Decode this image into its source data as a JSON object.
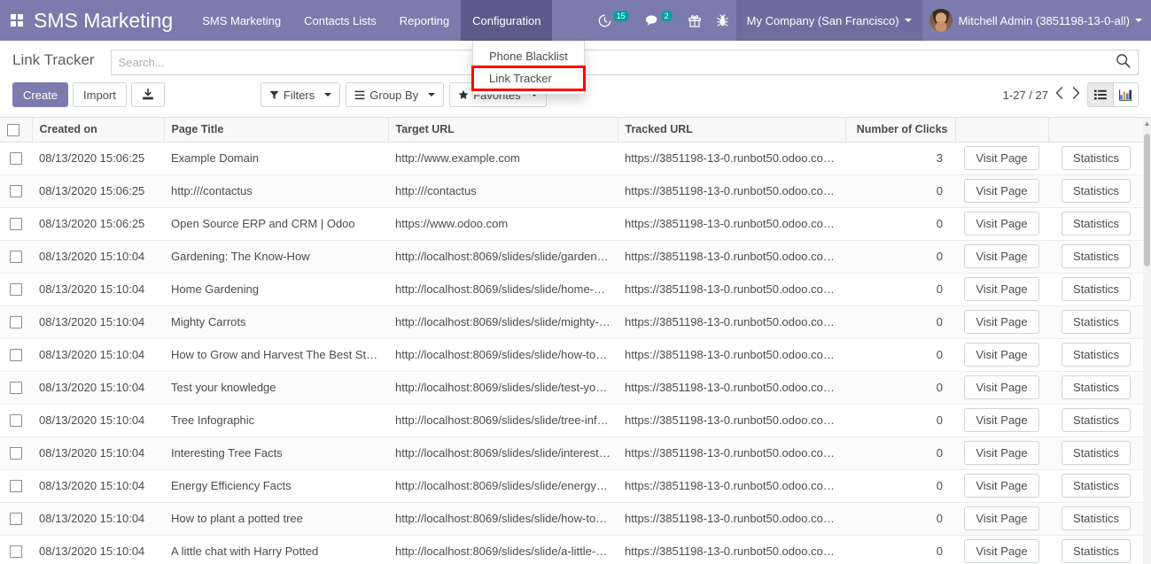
{
  "navbar": {
    "apps_icon": "apps-grid-icon",
    "brand": "SMS Marketing",
    "menus": [
      {
        "label": "SMS Marketing",
        "active": false
      },
      {
        "label": "Contacts Lists",
        "active": false
      },
      {
        "label": "Reporting",
        "active": false
      },
      {
        "label": "Configuration",
        "active": true
      }
    ],
    "systray": [
      {
        "icon": "activity-clock-icon",
        "badge": "15"
      },
      {
        "icon": "messaging-chat-icon",
        "badge": "2"
      },
      {
        "icon": "gift-icon",
        "badge": ""
      },
      {
        "icon": "debug-bug-icon",
        "badge": ""
      }
    ],
    "company": "My Company (San Francisco)",
    "user": "Mitchell Admin (3851198-13-0-all)"
  },
  "dropdown": {
    "items": [
      {
        "label": "Phone Blacklist",
        "highlighted": false
      },
      {
        "label": "Link Tracker",
        "highlighted": true
      }
    ]
  },
  "control_panel": {
    "title": "Link Tracker",
    "create_label": "Create",
    "import_label": "Import",
    "export_icon": "download-tray-icon",
    "search_placeholder": "Search...",
    "search_value": "",
    "search_icon": "search-magnifier-icon",
    "filters_label": "Filters",
    "group_by_label": "Group By",
    "favorites_label": "Favorites",
    "pager": "1-27 / 27",
    "prev_icon": "chevron-left-icon",
    "next_icon": "chevron-right-icon",
    "view_list_icon": "list-view-icon",
    "view_graph_icon": "bar-chart-view-icon"
  },
  "colors": {
    "brand_purple": "#7c7bad",
    "menu_active": "#5c5b8c",
    "company_bg": "#6e6d9e",
    "badge_green": "#00a09d",
    "highlight_red": "#ff0000"
  },
  "table": {
    "columns": [
      "Created on",
      "Page Title",
      "Target URL",
      "Tracked URL",
      "Number of Clicks"
    ],
    "row_buttons": {
      "visit": "Visit Page",
      "statistics": "Statistics"
    },
    "rows": [
      {
        "created_on": "08/13/2020 15:06:25",
        "page_title": "Example Domain",
        "target_url": "http://www.example.com",
        "tracked_url": "https://3851198-13-0.runbot50.odoo.com…",
        "clicks": "3"
      },
      {
        "created_on": "08/13/2020 15:06:25",
        "page_title": "http:///contactus",
        "target_url": "http:///contactus",
        "tracked_url": "https://3851198-13-0.runbot50.odoo.com…",
        "clicks": "0"
      },
      {
        "created_on": "08/13/2020 15:06:25",
        "page_title": "Open Source ERP and CRM | Odoo",
        "target_url": "https://www.odoo.com",
        "tracked_url": "https://3851198-13-0.runbot50.odoo.com…",
        "clicks": "0"
      },
      {
        "created_on": "08/13/2020 15:10:04",
        "page_title": "Gardening: The Know-How",
        "target_url": "http://localhost:8069/slides/slide/gardeni…",
        "tracked_url": "https://3851198-13-0.runbot50.odoo.com…",
        "clicks": "0"
      },
      {
        "created_on": "08/13/2020 15:10:04",
        "page_title": "Home Gardening",
        "target_url": "http://localhost:8069/slides/slide/home-g…",
        "tracked_url": "https://3851198-13-0.runbot50.odoo.com…",
        "clicks": "0"
      },
      {
        "created_on": "08/13/2020 15:10:04",
        "page_title": "Mighty Carrots",
        "target_url": "http://localhost:8069/slides/slide/mighty-…",
        "tracked_url": "https://3851198-13-0.runbot50.odoo.com…",
        "clicks": "0"
      },
      {
        "created_on": "08/13/2020 15:10:04",
        "page_title": "How to Grow and Harvest The Best Stra…",
        "target_url": "http://localhost:8069/slides/slide/how-to-…",
        "tracked_url": "https://3851198-13-0.runbot50.odoo.com…",
        "clicks": "0"
      },
      {
        "created_on": "08/13/2020 15:10:04",
        "page_title": "Test your knowledge",
        "target_url": "http://localhost:8069/slides/slide/test-you…",
        "tracked_url": "https://3851198-13-0.runbot50.odoo.com…",
        "clicks": "0"
      },
      {
        "created_on": "08/13/2020 15:10:04",
        "page_title": "Tree Infographic",
        "target_url": "http://localhost:8069/slides/slide/tree-info…",
        "tracked_url": "https://3851198-13-0.runbot50.odoo.com…",
        "clicks": "0"
      },
      {
        "created_on": "08/13/2020 15:10:04",
        "page_title": "Interesting Tree Facts",
        "target_url": "http://localhost:8069/slides/slide/interesti…",
        "tracked_url": "https://3851198-13-0.runbot50.odoo.com…",
        "clicks": "0"
      },
      {
        "created_on": "08/13/2020 15:10:04",
        "page_title": "Energy Efficiency Facts",
        "target_url": "http://localhost:8069/slides/slide/energy-…",
        "tracked_url": "https://3851198-13-0.runbot50.odoo.com…",
        "clicks": "0"
      },
      {
        "created_on": "08/13/2020 15:10:04",
        "page_title": "How to plant a potted tree",
        "target_url": "http://localhost:8069/slides/slide/how-to-…",
        "tracked_url": "https://3851198-13-0.runbot50.odoo.com…",
        "clicks": "0"
      },
      {
        "created_on": "08/13/2020 15:10:04",
        "page_title": "A little chat with Harry Potted",
        "target_url": "http://localhost:8069/slides/slide/a-little-c…",
        "tracked_url": "https://3851198-13-0.runbot50.odoo.com…",
        "clicks": "0"
      }
    ]
  }
}
